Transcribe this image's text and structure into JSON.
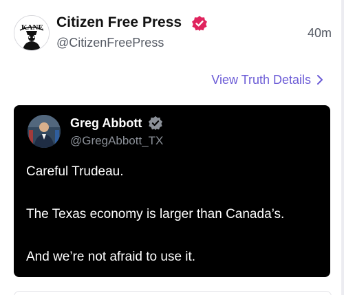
{
  "post": {
    "author_name": "Citizen Free Press",
    "handle": "@CitizenFreePress",
    "time": "40m",
    "avatar_icon": "kane-logo-avatar",
    "avatar_text": "KANE",
    "verified_icon": "verified-badge-icon",
    "verified_color": "#e0245e"
  },
  "view_link": {
    "label": "View Truth Details",
    "color": "#6b5bd6"
  },
  "embedded_post": {
    "author_name": "Greg Abbott",
    "handle": "@GregAbbott_TX",
    "verified_color": "#8b9098",
    "lines": [
      "Careful Trudeau.",
      "The Texas economy is larger than Canada’s.",
      "And we’re not afraid to use it."
    ]
  }
}
